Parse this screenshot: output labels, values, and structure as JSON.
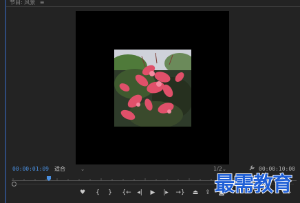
{
  "panel": {
    "title": "节目: 风景",
    "menu_glyph": "≡"
  },
  "monitor": {
    "current_timecode": "00:00:01:09",
    "fit_select": "适合",
    "resolution": "1/2",
    "duration_timecode": "00:00:10:00"
  },
  "icons": {
    "dropdown": "⌄",
    "wrench": "🔧",
    "marker": "♥",
    "mark_in": "{",
    "mark_out": "}",
    "go_to_in": "{←",
    "step_back": "◂|",
    "play": "▶",
    "step_forward": "|▸",
    "go_to_out": "→}",
    "lift": "⏏",
    "extract": "⇪",
    "export_frame": "◙",
    "button_editor": "+"
  },
  "watermark": {
    "text": "最需教育"
  },
  "colors": {
    "timecode_blue": "#4a90e2",
    "panel_bg": "#232323",
    "watermark_blue": "#1f5fd6"
  }
}
